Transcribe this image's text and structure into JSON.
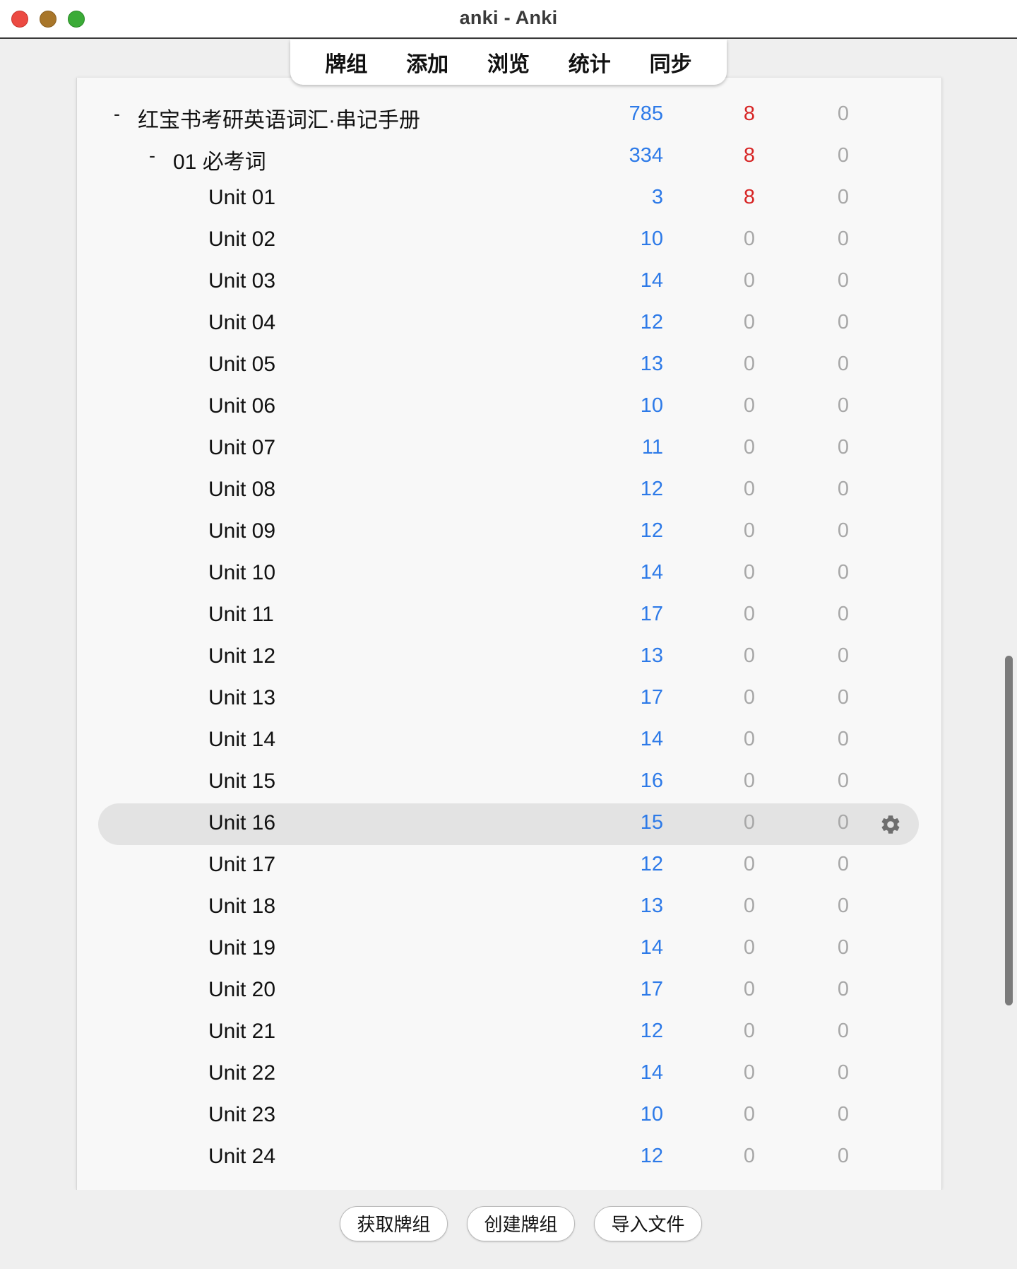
{
  "window": {
    "title": "anki - Anki"
  },
  "toolbar": {
    "decks_label": "牌组",
    "add_label": "添加",
    "browse_label": "浏览",
    "stats_label": "统计",
    "sync_label": "同步"
  },
  "decks": [
    {
      "collapse": "-",
      "name": "红宝书考研英语词汇·串记手册",
      "new": "785",
      "learn": "8",
      "review": "0"
    },
    {
      "collapse": "-",
      "name": "01 必考词",
      "new": "334",
      "learn": "8",
      "review": "0"
    },
    {
      "collapse": "",
      "name": "Unit 01",
      "new": "3",
      "learn": "8",
      "review": "0"
    },
    {
      "collapse": "",
      "name": "Unit 02",
      "new": "10",
      "learn": "0",
      "review": "0"
    },
    {
      "collapse": "",
      "name": "Unit 03",
      "new": "14",
      "learn": "0",
      "review": "0"
    },
    {
      "collapse": "",
      "name": "Unit 04",
      "new": "12",
      "learn": "0",
      "review": "0"
    },
    {
      "collapse": "",
      "name": "Unit 05",
      "new": "13",
      "learn": "0",
      "review": "0"
    },
    {
      "collapse": "",
      "name": "Unit 06",
      "new": "10",
      "learn": "0",
      "review": "0"
    },
    {
      "collapse": "",
      "name": "Unit 07",
      "new": "11",
      "learn": "0",
      "review": "0"
    },
    {
      "collapse": "",
      "name": "Unit 08",
      "new": "12",
      "learn": "0",
      "review": "0"
    },
    {
      "collapse": "",
      "name": "Unit 09",
      "new": "12",
      "learn": "0",
      "review": "0"
    },
    {
      "collapse": "",
      "name": "Unit 10",
      "new": "14",
      "learn": "0",
      "review": "0"
    },
    {
      "collapse": "",
      "name": "Unit 11",
      "new": "17",
      "learn": "0",
      "review": "0"
    },
    {
      "collapse": "",
      "name": "Unit 12",
      "new": "13",
      "learn": "0",
      "review": "0"
    },
    {
      "collapse": "",
      "name": "Unit 13",
      "new": "17",
      "learn": "0",
      "review": "0"
    },
    {
      "collapse": "",
      "name": "Unit 14",
      "new": "14",
      "learn": "0",
      "review": "0"
    },
    {
      "collapse": "",
      "name": "Unit 15",
      "new": "16",
      "learn": "0",
      "review": "0"
    },
    {
      "collapse": "",
      "name": "Unit 16",
      "new": "15",
      "learn": "0",
      "review": "0",
      "selected": true
    },
    {
      "collapse": "",
      "name": "Unit 17",
      "new": "12",
      "learn": "0",
      "review": "0"
    },
    {
      "collapse": "",
      "name": "Unit 18",
      "new": "13",
      "learn": "0",
      "review": "0"
    },
    {
      "collapse": "",
      "name": "Unit 19",
      "new": "14",
      "learn": "0",
      "review": "0"
    },
    {
      "collapse": "",
      "name": "Unit 20",
      "new": "17",
      "learn": "0",
      "review": "0"
    },
    {
      "collapse": "",
      "name": "Unit 21",
      "new": "12",
      "learn": "0",
      "review": "0"
    },
    {
      "collapse": "",
      "name": "Unit 22",
      "new": "14",
      "learn": "0",
      "review": "0"
    },
    {
      "collapse": "",
      "name": "Unit 23",
      "new": "10",
      "learn": "0",
      "review": "0"
    },
    {
      "collapse": "",
      "name": "Unit 24",
      "new": "12",
      "learn": "0",
      "review": "0"
    }
  ],
  "colors": {
    "new_count": "#2d7ae8",
    "learn_count": "#d72525",
    "zero_count": "#a8a8a8"
  },
  "icons": {
    "row_options": "gear-icon"
  },
  "footer": {
    "get_shared_label": "获取牌组",
    "create_deck_label": "创建牌组",
    "import_file_label": "导入文件"
  }
}
